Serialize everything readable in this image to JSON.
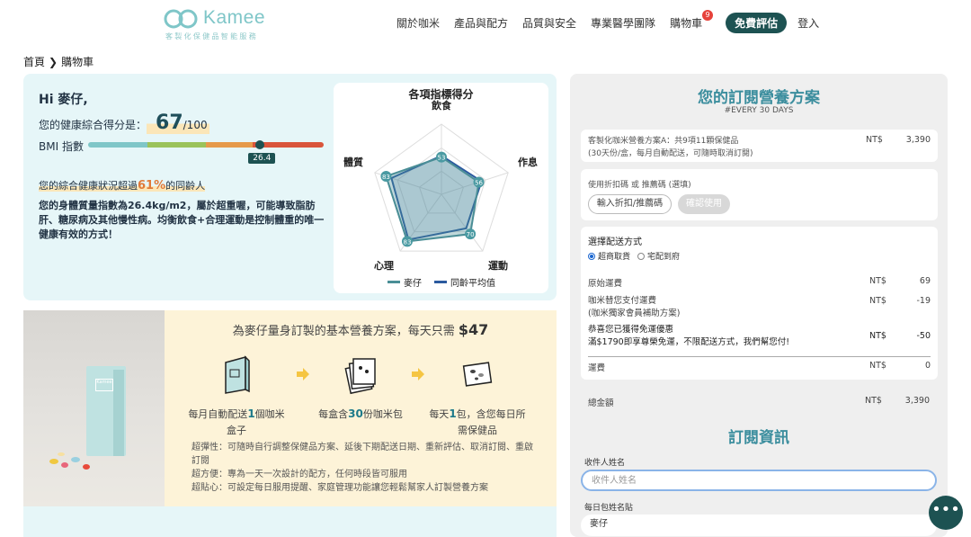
{
  "brand": {
    "name": "Kamee",
    "tagline": "客製化保健品智能服務"
  },
  "nav": {
    "items": [
      "關於咖米",
      "產品與配方",
      "品質與安全",
      "專業醫學團隊"
    ],
    "cart_label": "購物車",
    "cart_count": "9",
    "cta": "免費評估",
    "login": "登入"
  },
  "breadcrumb": {
    "home": "首頁",
    "current": "購物車"
  },
  "health": {
    "greeting": "Hi 麥仔,",
    "score_label": "您的健康綜合得分是：",
    "score": "67",
    "score_max": "/100",
    "bmi_label": "BMI 指數",
    "bmi_value": "26.4",
    "bmi_fraction": 0.73,
    "compare_prefix": "您的綜合健康狀況超過",
    "compare_pct": "61%",
    "compare_suffix": "的同齡人",
    "advice": "您的身體質量指數為26.4kg/m2，屬於超重喔，可能導致脂肪肝、糖尿病及其他慢性病。均衡飲食+合理運動是控制體重的唯一健康有效的方式！"
  },
  "radar": {
    "title": "各項指標得分",
    "axes": [
      "飲食",
      "作息",
      "運動",
      "心理",
      "體質"
    ],
    "user_name": "麥仔",
    "peer_name": "同齡平均值",
    "user_values": [
      53,
      56,
      70,
      83,
      83
    ],
    "peer_values": [
      55,
      60,
      60,
      80,
      75
    ],
    "max": 100,
    "colors": {
      "user": "#4a8e96",
      "peer": "#2b5a9e"
    }
  },
  "plan": {
    "title_prefix": "為麥仔量身訂製的基本營養方案，每天只需",
    "price": "$47",
    "steps": [
      {
        "pre": "每月自動配送",
        "hl": "1",
        "post": "個咖米盒子"
      },
      {
        "pre": "每盒含",
        "hl": "30",
        "post": "份咖米包"
      },
      {
        "pre": "每天",
        "hl": "1",
        "post": "包，含您每日所需保健品"
      }
    ],
    "features": [
      "超彈性：可隨時自行調整保健品方案、延後下期配送日期、重新評估、取消訂閱、重啟訂閱",
      "超方便：專為一天一次設計的配方，任何時段皆可服用",
      "超貼心：可設定每日服用提醒、家庭管理功能讓您輕鬆幫家人訂製營養方案"
    ],
    "box_label": "Kamee"
  },
  "order": {
    "title": "您的訂閱營養方案",
    "subtitle": "#EVERY 30 DAYS",
    "item_line1": "客製化咖米營養方案A：共9項11顆保健品",
    "item_line2": "(30天份/盒，每月自動配送，可隨時取消訂閱)",
    "currency": "NT$",
    "item_amount": "3,390",
    "promo_label": "使用折扣碼 或 推薦碼 (選填)",
    "promo_placeholder": "輸入折扣/推薦碼",
    "promo_button": "確認使用",
    "shipping_title": "選擇配送方式",
    "shipping_options": [
      "超商取貨",
      "宅配到府"
    ],
    "lines": [
      {
        "label": "原始運費",
        "amount": "69"
      },
      {
        "label": "咖米替您支付運費",
        "label2": "(咖米獨家會員補助方案)",
        "amount": "-19"
      },
      {
        "label": "恭喜您已獲得免運優惠",
        "label2": "滿$1790即享尊榮免運，不限配送方式，我們幫您付!",
        "amount": "-50"
      }
    ],
    "shipping_total_label": "運費",
    "shipping_total": "0",
    "total_label": "總金額",
    "total": "3,390"
  },
  "subscription": {
    "title": "訂閱資訊",
    "name_label": "收件人姓名",
    "name_placeholder": "收件人姓名",
    "nick_label": "每日包姓名貼",
    "nick_value": "麥仔"
  },
  "chat": {
    "icon": "chat-icon"
  }
}
